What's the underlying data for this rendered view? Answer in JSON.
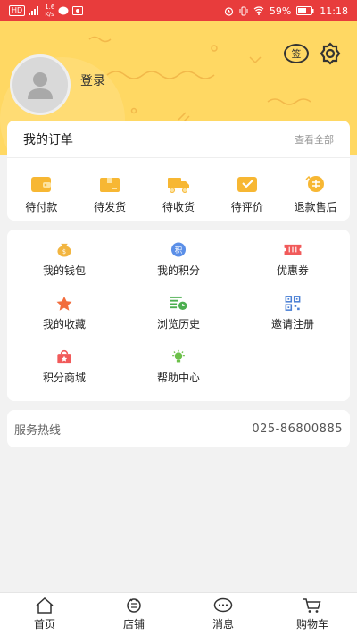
{
  "status_bar": {
    "carrier_chip": "HD",
    "speed_value": "1.6",
    "speed_unit": "K/s",
    "battery": "59%",
    "time": "11:18"
  },
  "profile": {
    "login_label": "登录",
    "sign_label": "签"
  },
  "orders": {
    "title": "我的订单",
    "view_all": "查看全部",
    "items": [
      {
        "label": "待付款",
        "icon": "wallet-icon"
      },
      {
        "label": "待发货",
        "icon": "box-icon"
      },
      {
        "label": "待收货",
        "icon": "truck-icon"
      },
      {
        "label": "待评价",
        "icon": "review-icon"
      },
      {
        "label": "退款售后",
        "icon": "refund-icon"
      }
    ]
  },
  "services": {
    "items": [
      {
        "label": "我的钱包",
        "icon": "money-bag-icon",
        "color": "#f2b540"
      },
      {
        "label": "我的积分",
        "icon": "points-icon",
        "color": "#5b8fe8",
        "glyph": "积"
      },
      {
        "label": "优惠券",
        "icon": "coupon-icon",
        "color": "#f15a5a"
      },
      {
        "label": "我的收藏",
        "icon": "star-icon",
        "color": "#f26d3d"
      },
      {
        "label": "浏览历史",
        "icon": "history-icon",
        "color": "#4caf50"
      },
      {
        "label": "邀请注册",
        "icon": "qr-code-icon",
        "color": "#4a7fd4"
      },
      {
        "label": "积分商城",
        "icon": "shopping-bag-icon",
        "color": "#f15a5a"
      },
      {
        "label": "帮助中心",
        "icon": "lightbulb-icon",
        "color": "#6cc04a"
      }
    ]
  },
  "hotline": {
    "label": "服务热线",
    "value": "025-86800885"
  },
  "tabbar": {
    "items": [
      {
        "label": "首页",
        "icon": "home-icon"
      },
      {
        "label": "店铺",
        "icon": "shop-icon"
      },
      {
        "label": "消息",
        "icon": "message-icon"
      },
      {
        "label": "购物车",
        "icon": "cart-icon"
      }
    ]
  },
  "colors": {
    "status_bar": "#e83c3c",
    "header": "#ffd863",
    "accent": "#f7b733"
  }
}
